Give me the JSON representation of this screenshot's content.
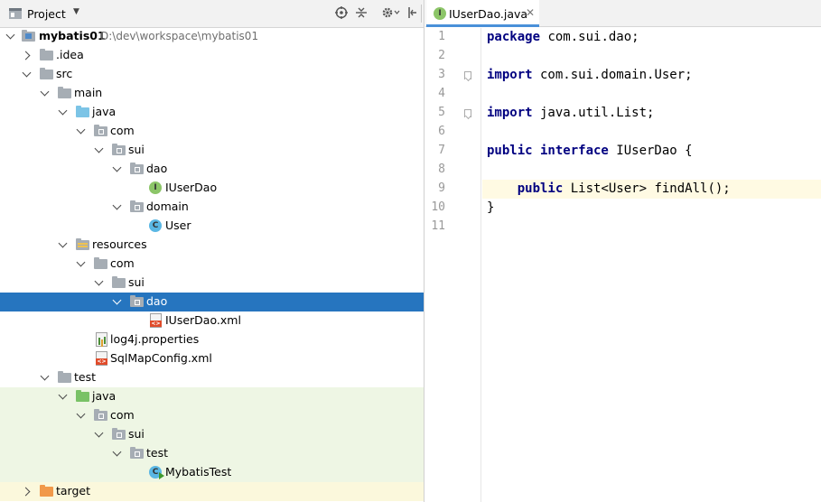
{
  "project_panel": {
    "title": "Project",
    "tree": [
      {
        "label": "mybatis01",
        "path": "D:\\dev\\workspace\\mybatis01"
      },
      {
        "label": ".idea"
      },
      {
        "label": "src"
      },
      {
        "label": "main"
      },
      {
        "label": "java"
      },
      {
        "label": "com"
      },
      {
        "label": "sui"
      },
      {
        "label": "dao"
      },
      {
        "label": "IUserDao"
      },
      {
        "label": "domain"
      },
      {
        "label": "User"
      },
      {
        "label": "resources"
      },
      {
        "label": "com"
      },
      {
        "label": "sui"
      },
      {
        "label": "dao"
      },
      {
        "label": "IUserDao.xml"
      },
      {
        "label": "log4j.properties"
      },
      {
        "label": "SqlMapConfig.xml"
      },
      {
        "label": "test"
      },
      {
        "label": "java"
      },
      {
        "label": "com"
      },
      {
        "label": "sui"
      },
      {
        "label": "test"
      },
      {
        "label": "MybatisTest"
      },
      {
        "label": "target"
      }
    ]
  },
  "editor": {
    "tab": {
      "label": "IUserDao.java",
      "icon_letter": "I"
    },
    "line_numbers": [
      "1",
      "2",
      "3",
      "4",
      "5",
      "6",
      "7",
      "8",
      "9",
      "10",
      "11"
    ],
    "lines": [
      {
        "kw": "package",
        "rest": " com.sui.dao;"
      },
      {
        "kw": "",
        "rest": ""
      },
      {
        "kw": "import",
        "rest": " com.sui.domain.User;"
      },
      {
        "kw": "",
        "rest": ""
      },
      {
        "kw": "import",
        "rest": " java.util.List;"
      },
      {
        "kw": "",
        "rest": ""
      },
      {
        "kw": "public interface",
        "rest": " IUserDao {"
      },
      {
        "kw": "",
        "rest": ""
      },
      {
        "kw": "    public",
        "rest": " List<User> findAll();"
      },
      {
        "kw": "",
        "rest": "}"
      },
      {
        "kw": "",
        "rest": ""
      }
    ],
    "colors": {
      "keyword": "#000080",
      "current_line": "#fffae3"
    }
  },
  "icons": {
    "interface": "I",
    "class": "C"
  },
  "colors": {
    "selection": "#2675bf",
    "test_bg": "#eef6e4",
    "target_bg": "#fbf8dc"
  }
}
